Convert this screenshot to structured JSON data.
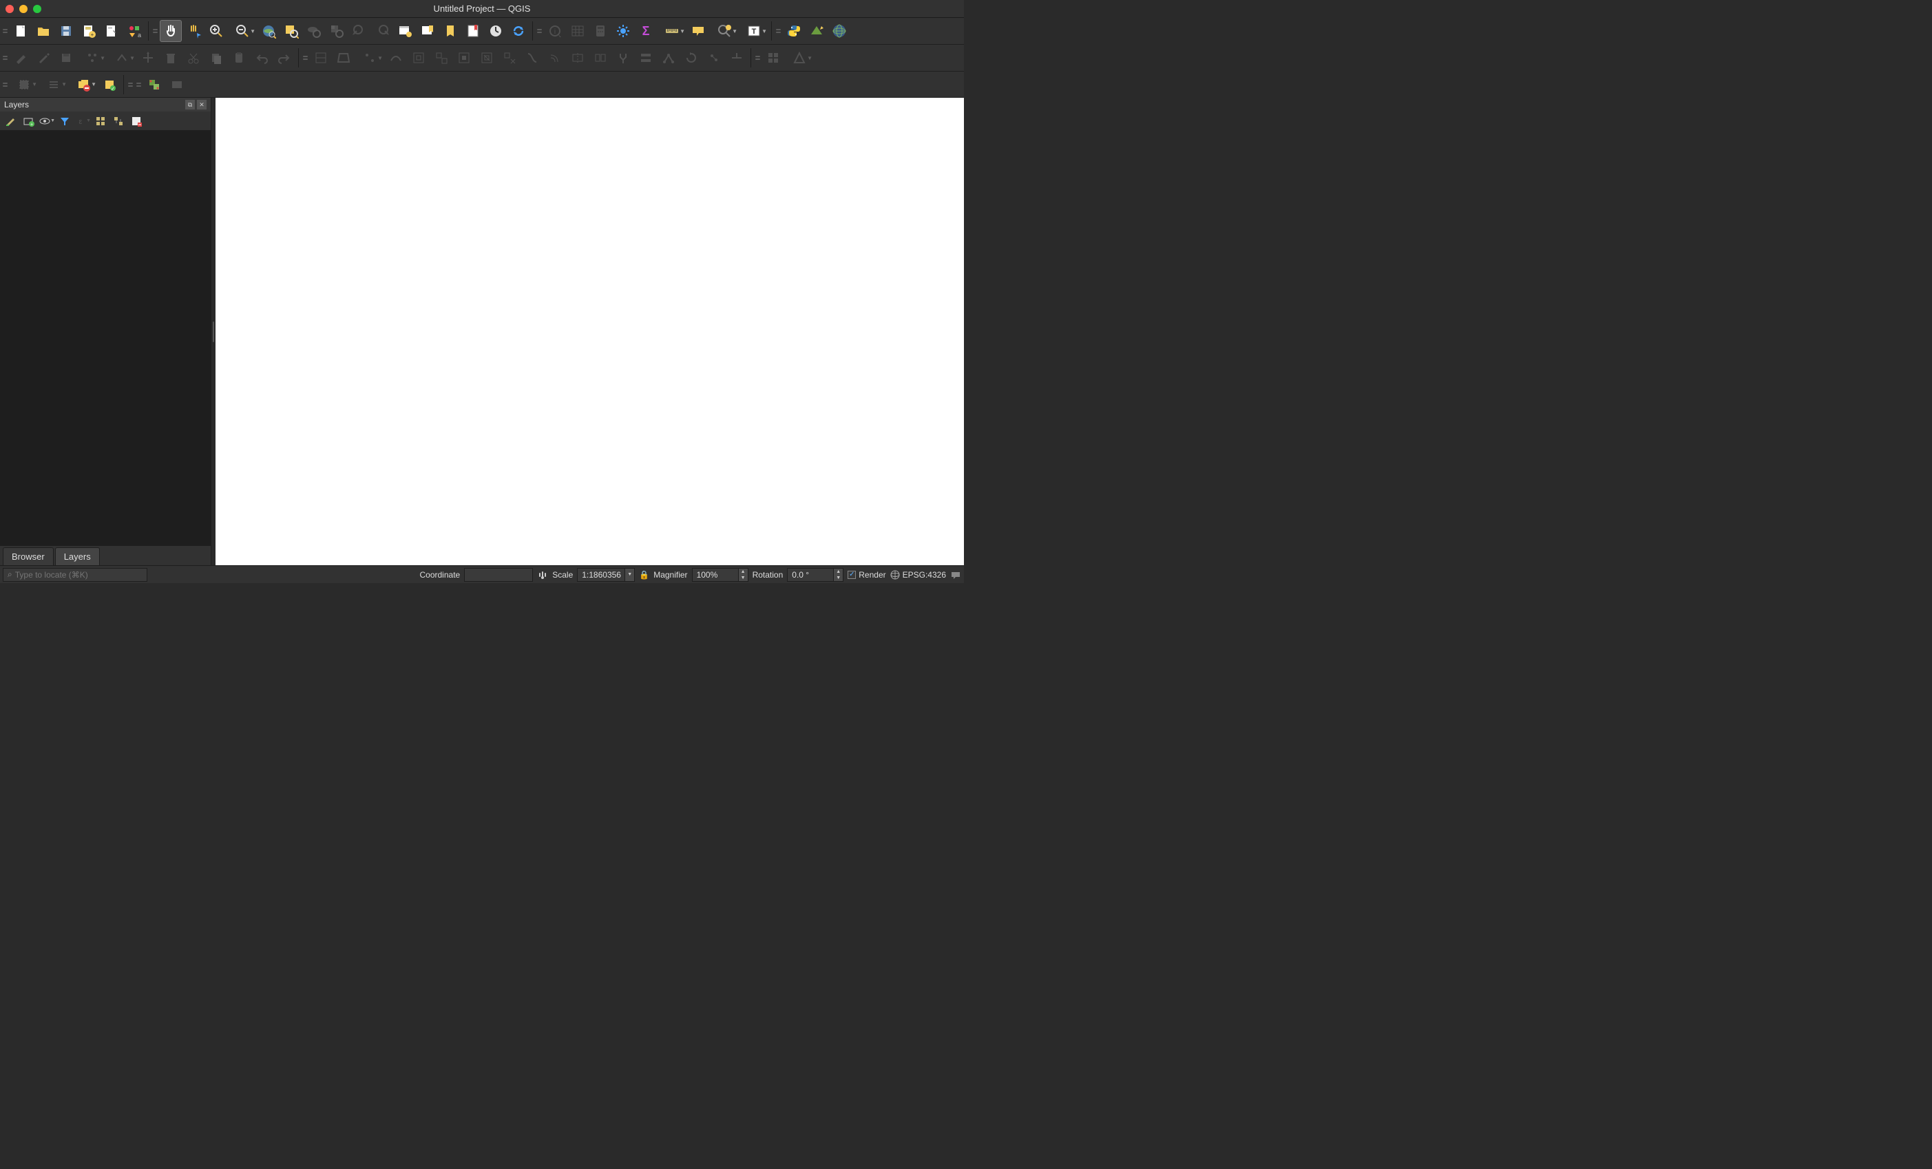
{
  "window": {
    "title": "Untitled Project — QGIS"
  },
  "layers_panel": {
    "title": "Layers"
  },
  "tabs": {
    "browser": "Browser",
    "layers": "Layers"
  },
  "locator": {
    "placeholder": "Type to locate (⌘K)"
  },
  "status": {
    "coordinate_label": "Coordinate",
    "scale_label": "Scale",
    "scale_value": "1:1860356",
    "magnifier_label": "Magnifier",
    "magnifier_value": "100%",
    "rotation_label": "Rotation",
    "rotation_value": "0.0 °",
    "render_label": "Render",
    "crs": "EPSG:4326"
  }
}
